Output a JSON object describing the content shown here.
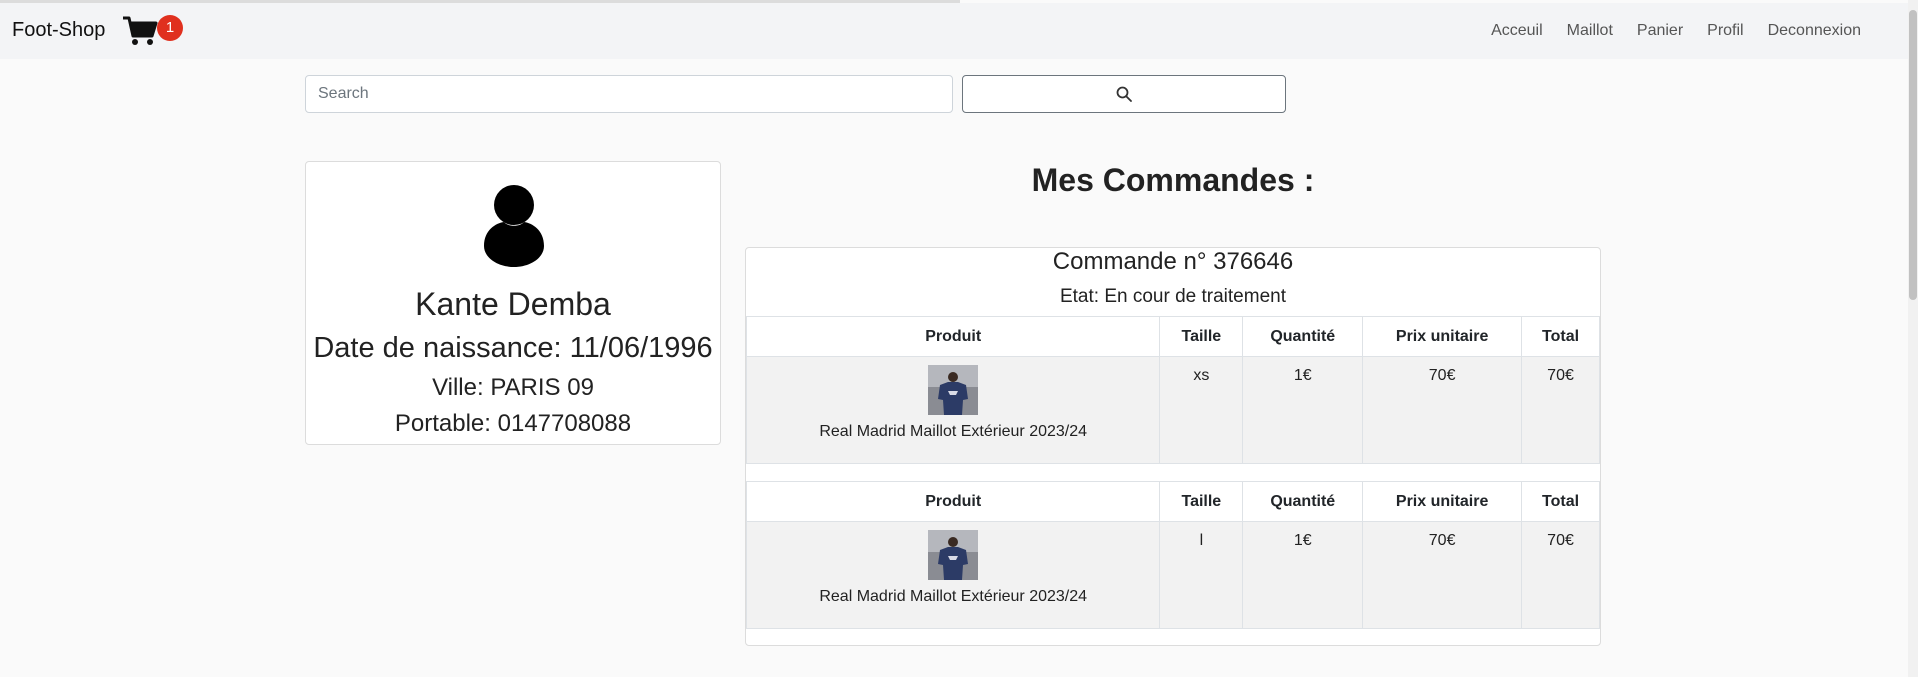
{
  "navbar": {
    "brand": "Foot-Shop",
    "cart_count": "1",
    "links": [
      "Acceuil",
      "Maillot",
      "Panier",
      "Profil",
      "Deconnexion"
    ]
  },
  "search": {
    "placeholder": "Search"
  },
  "profile": {
    "name": "Kante Demba",
    "dob": "Date de naissance: 11/06/1996",
    "city": "Ville: PARIS 09",
    "phone": "Portable: 0147708088"
  },
  "orders": {
    "title": "Mes Commandes :",
    "list": [
      {
        "number": "Commande n° 376646",
        "state": "Etat: En cour de traitement",
        "headers": [
          "Produit",
          "Taille",
          "Quantité",
          "Prix unitaire",
          "Total"
        ],
        "items": [
          {
            "product": "Real Madrid Maillot Extérieur 2023/24",
            "size": "xs",
            "quantity": "1€",
            "unit_price": "70€",
            "total": "70€"
          },
          {
            "product": "Real Madrid Maillot Extérieur 2023/24",
            "size": "l",
            "quantity": "1€",
            "unit_price": "70€",
            "total": "70€"
          }
        ]
      }
    ]
  },
  "icons": {
    "cart": "cart-icon",
    "search": "search-icon",
    "avatar": "user-icon",
    "jersey": "jersey-thumbnail"
  },
  "colors": {
    "badge": "#e0301e",
    "navbar_bg": "#f3f4f6"
  }
}
